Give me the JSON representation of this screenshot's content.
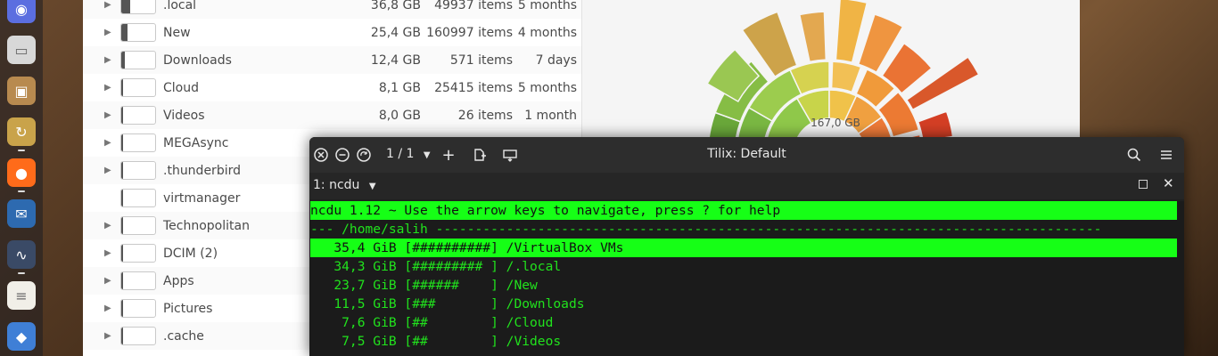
{
  "dock": {
    "items": [
      {
        "icon": "browser-icon",
        "color": "#5b6ee0"
      },
      {
        "icon": "files-icon",
        "color": "#d8d8d8"
      },
      {
        "icon": "archive-icon",
        "color": "#b88a4f"
      },
      {
        "icon": "backup-icon",
        "color": "#c9a34a"
      },
      {
        "icon": "firefox-icon",
        "color": "#ff6b1a"
      },
      {
        "icon": "thunderbird-icon",
        "color": "#2d6ab0"
      },
      {
        "icon": "system-monitor-icon",
        "color": "#3a4a66"
      },
      {
        "icon": "notes-icon",
        "color": "#f1efe8"
      },
      {
        "icon": "app-icon",
        "color": "#3f7fd6"
      }
    ]
  },
  "files": {
    "rows": [
      {
        "name": ".local",
        "size": "36,8 GB",
        "items": "49937 items",
        "age": "5 months",
        "expandable": true,
        "fill": 0.85
      },
      {
        "name": "New",
        "size": "25,4 GB",
        "items": "160997 items",
        "age": "4 months",
        "expandable": true,
        "fill": 0.6
      },
      {
        "name": "Downloads",
        "size": "12,4 GB",
        "items": "571 items",
        "age": "7 days",
        "expandable": true,
        "fill": 0.3
      },
      {
        "name": "Cloud",
        "size": "8,1 GB",
        "items": "25415 items",
        "age": "5 months",
        "expandable": true,
        "fill": 0.2
      },
      {
        "name": "Videos",
        "size": "8,0 GB",
        "items": "26 items",
        "age": "1 month",
        "expandable": true,
        "fill": 0.2
      },
      {
        "name": "MEGAsync",
        "size": "",
        "items": "",
        "age": "",
        "expandable": true,
        "fill": 0.1
      },
      {
        "name": ".thunderbird",
        "size": "",
        "items": "",
        "age": "",
        "expandable": true,
        "fill": 0.05
      },
      {
        "name": "virtmanager",
        "size": "",
        "items": "",
        "age": "",
        "expandable": false,
        "fill": 0.03
      },
      {
        "name": "Technopolitan",
        "size": "",
        "items": "",
        "age": "",
        "expandable": true,
        "fill": 0.03
      },
      {
        "name": "DCIM (2)",
        "size": "",
        "items": "",
        "age": "",
        "expandable": true,
        "fill": 0.02
      },
      {
        "name": "Apps",
        "size": "",
        "items": "",
        "age": "",
        "expandable": true,
        "fill": 0.02
      },
      {
        "name": "Pictures",
        "size": "",
        "items": "",
        "age": "",
        "expandable": true,
        "fill": 0.02
      },
      {
        "name": ".cache",
        "size": "",
        "items": "",
        "age": "",
        "expandable": true,
        "fill": 0.02
      }
    ]
  },
  "chart": {
    "total": "167,0 GB"
  },
  "terminal": {
    "title": "Tilix: Default",
    "page": "1 / 1",
    "session": "1: ncdu",
    "lines": [
      {
        "text": "ncdu 1.12 ~ Use the arrow keys to navigate, press ? for help",
        "highlight": true
      },
      {
        "text": "--- /home/salih -------------------------------------------------------------------------------------",
        "highlight": false
      },
      {
        "text": "   35,4 GiB [##########] /VirtualBox VMs",
        "highlight": true
      },
      {
        "text": "   34,3 GiB [######### ] /.local",
        "highlight": false
      },
      {
        "text": "   23,7 GiB [######    ] /New",
        "highlight": false
      },
      {
        "text": "   11,5 GiB [###       ] /Downloads",
        "highlight": false
      },
      {
        "text": "    7,6 GiB [##        ] /Cloud",
        "highlight": false
      },
      {
        "text": "    7,5 GiB [##        ] /Videos",
        "highlight": false
      }
    ]
  }
}
